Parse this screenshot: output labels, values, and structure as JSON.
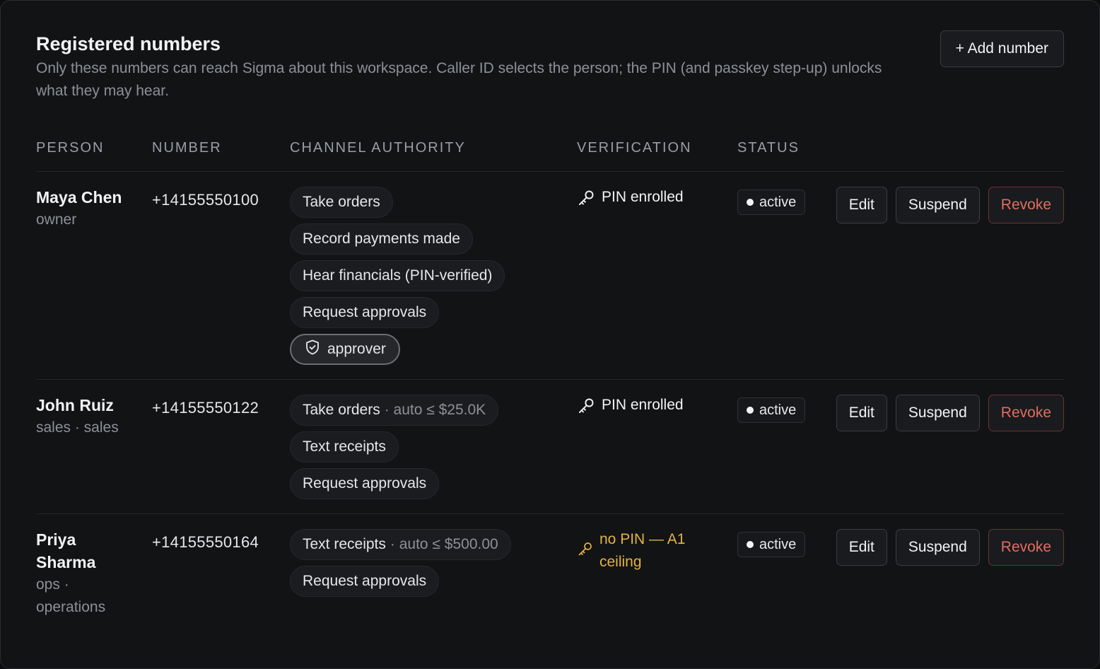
{
  "header": {
    "title": "Registered numbers",
    "subtitle": "Only these numbers can reach Sigma about this workspace. Caller ID selects the person; the PIN (and passkey step-up) unlocks what they may hear.",
    "add_label": "+ Add number"
  },
  "columns": [
    "PERSON",
    "NUMBER",
    "CHANNEL AUTHORITY",
    "VERIFICATION",
    "STATUS"
  ],
  "actions": {
    "edit": "Edit",
    "suspend": "Suspend",
    "revoke": "Revoke"
  },
  "rows": [
    {
      "name": "Maya Chen",
      "role": "owner",
      "number": "+14155550100",
      "chips": [
        {
          "label": "Take orders",
          "note": ""
        },
        {
          "label": "Record payments made",
          "note": ""
        },
        {
          "label": "Hear financials (PIN-verified)",
          "note": ""
        },
        {
          "label": "Request approvals",
          "note": ""
        }
      ],
      "approver_label": "approver",
      "verification": "PIN enrolled",
      "status": "active"
    },
    {
      "name": "John Ruiz",
      "role": "sales · sales",
      "number": "+14155550122",
      "chips": [
        {
          "label": "Take orders",
          "note": "· auto ≤ $25.0K"
        },
        {
          "label": "Text receipts",
          "note": ""
        },
        {
          "label": "Request approvals",
          "note": ""
        }
      ],
      "verification": "PIN enrolled",
      "status": "active"
    },
    {
      "name": "Priya Sharma",
      "role": "ops · operations",
      "number": "+14155550164",
      "chips": [
        {
          "label": "Text receipts",
          "note": "· auto ≤ $500.00"
        },
        {
          "label": "Request approvals",
          "note": ""
        }
      ],
      "verification": "no PIN — A1 ceiling",
      "status": "active"
    }
  ],
  "colors": {
    "warning": "#e3b341",
    "danger": "#e26d62"
  }
}
